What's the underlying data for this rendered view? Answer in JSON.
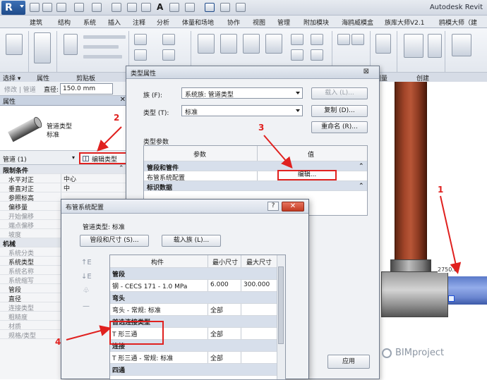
{
  "app": {
    "logo_letter": "R",
    "title": "Autodesk Revit"
  },
  "ribbon": {
    "tabs": [
      "建筑",
      "结构",
      "系统",
      "插入",
      "注释",
      "分析",
      "体量和场地",
      "协作",
      "视图",
      "管理",
      "附加模块",
      "海鸥威模盒",
      "族库大师V2.1",
      "鸥模大师（建"
    ],
    "group_labels": {
      "select": "选择 ▾",
      "properties": "属性",
      "clipboard": "剪贴板",
      "measure": "测量",
      "create": "创建"
    }
  },
  "options_bar": {
    "modify_label": "修改 | 管道",
    "diameter_label": "直径:",
    "diameter_value": "150.0 mm"
  },
  "properties": {
    "header": "属性",
    "close": "✕",
    "family_type": "管道类型",
    "family_type_sub": "标准",
    "selector": "管道 (1)",
    "edit_type": "编辑类型",
    "rows": [
      {
        "name": "限制条件",
        "value": "",
        "kind": "cat",
        "marker": "⌃"
      },
      {
        "name": "水平对正",
        "value": "中心",
        "kind": "row"
      },
      {
        "name": "垂直对正",
        "value": "中",
        "kind": "row"
      },
      {
        "name": "参照标高",
        "value": "",
        "kind": "row"
      },
      {
        "name": "偏移量",
        "value": "",
        "kind": "row"
      },
      {
        "name": "开始偏移",
        "value": "",
        "kind": "dim"
      },
      {
        "name": "端点偏移",
        "value": "",
        "kind": "dim"
      },
      {
        "name": "坡度",
        "value": "",
        "kind": "dim"
      },
      {
        "name": "机械",
        "value": "",
        "kind": "cat"
      },
      {
        "name": "系统分类",
        "value": "",
        "kind": "dim"
      },
      {
        "name": "系统类型",
        "value": "",
        "kind": "row"
      },
      {
        "name": "系统名称",
        "value": "",
        "kind": "dim"
      },
      {
        "name": "系统缩写",
        "value": "",
        "kind": "dim"
      },
      {
        "name": "管段",
        "value": "",
        "kind": "row"
      },
      {
        "name": "直径",
        "value": "",
        "kind": "row"
      },
      {
        "name": "连接类型",
        "value": "",
        "kind": "dim"
      },
      {
        "name": "粗糙度",
        "value": "",
        "kind": "dim"
      },
      {
        "name": "材质",
        "value": "",
        "kind": "dim"
      },
      {
        "name": "规格/类型",
        "value": "",
        "kind": "dim"
      }
    ]
  },
  "type_dialog": {
    "title": "类型属性",
    "close": "⊠",
    "family_label": "族 (F):",
    "family_value": "系统族: 管道类型",
    "type_label": "类型 (T):",
    "type_value": "标准",
    "load_btn": "载入 (L)...",
    "duplicate_btn": "复制 (D)...",
    "rename_btn": "重命名 (R)...",
    "params_label": "类型参数",
    "col_param": "参数",
    "col_value": "值",
    "group1": "管段和管件",
    "group1_marker": "⌃",
    "row1_name": "布管系统配置",
    "row1_btn": "编辑...",
    "group2": "标识数据",
    "group2_marker": "⌃",
    "apply_btn": "应用"
  },
  "route_dialog": {
    "title": "布管系统配置",
    "help": "?",
    "close": "✕",
    "pipe_type_label": "管道类型: 标准",
    "segments_btn": "管段和尺寸 (S)...",
    "load_family_btn": "载入族 (L)...",
    "col_member": "构件",
    "col_min": "最小尺寸",
    "col_max": "最大尺寸",
    "rows": [
      {
        "kind": "group",
        "member": "管段",
        "min": "",
        "max": ""
      },
      {
        "kind": "row",
        "member": "钢 - CECS 171 - 1.0 MPa",
        "min": "6.000",
        "max": "300.000"
      },
      {
        "kind": "group",
        "member": "弯头",
        "min": "",
        "max": ""
      },
      {
        "kind": "row",
        "member": "弯头 - 常规: 标准",
        "min": "全部",
        "max": ""
      },
      {
        "kind": "group",
        "member": "首选连接类型",
        "min": "",
        "max": ""
      },
      {
        "kind": "row",
        "member": "T 形三通",
        "min": "全部",
        "max": ""
      },
      {
        "kind": "group",
        "member": "连接",
        "min": "",
        "max": ""
      },
      {
        "kind": "row",
        "member": "T 形三通 - 常规: 标准",
        "min": "全部",
        "max": ""
      },
      {
        "kind": "group",
        "member": "四通",
        "min": "",
        "max": ""
      }
    ],
    "side_buttons": [
      "↑E",
      "↓E",
      "♧",
      "—"
    ]
  },
  "canvas": {
    "dimension_text": "2750.0"
  },
  "annotations": [
    "1",
    "2",
    "3",
    "4"
  ],
  "watermark": "BIMproject",
  "colors": {
    "callout_red": "#e0211f",
    "vertical_pipe": "#a3462a",
    "horizontal_pipe": "#7f99dd",
    "ribbon_blue": "#d6dde8"
  }
}
